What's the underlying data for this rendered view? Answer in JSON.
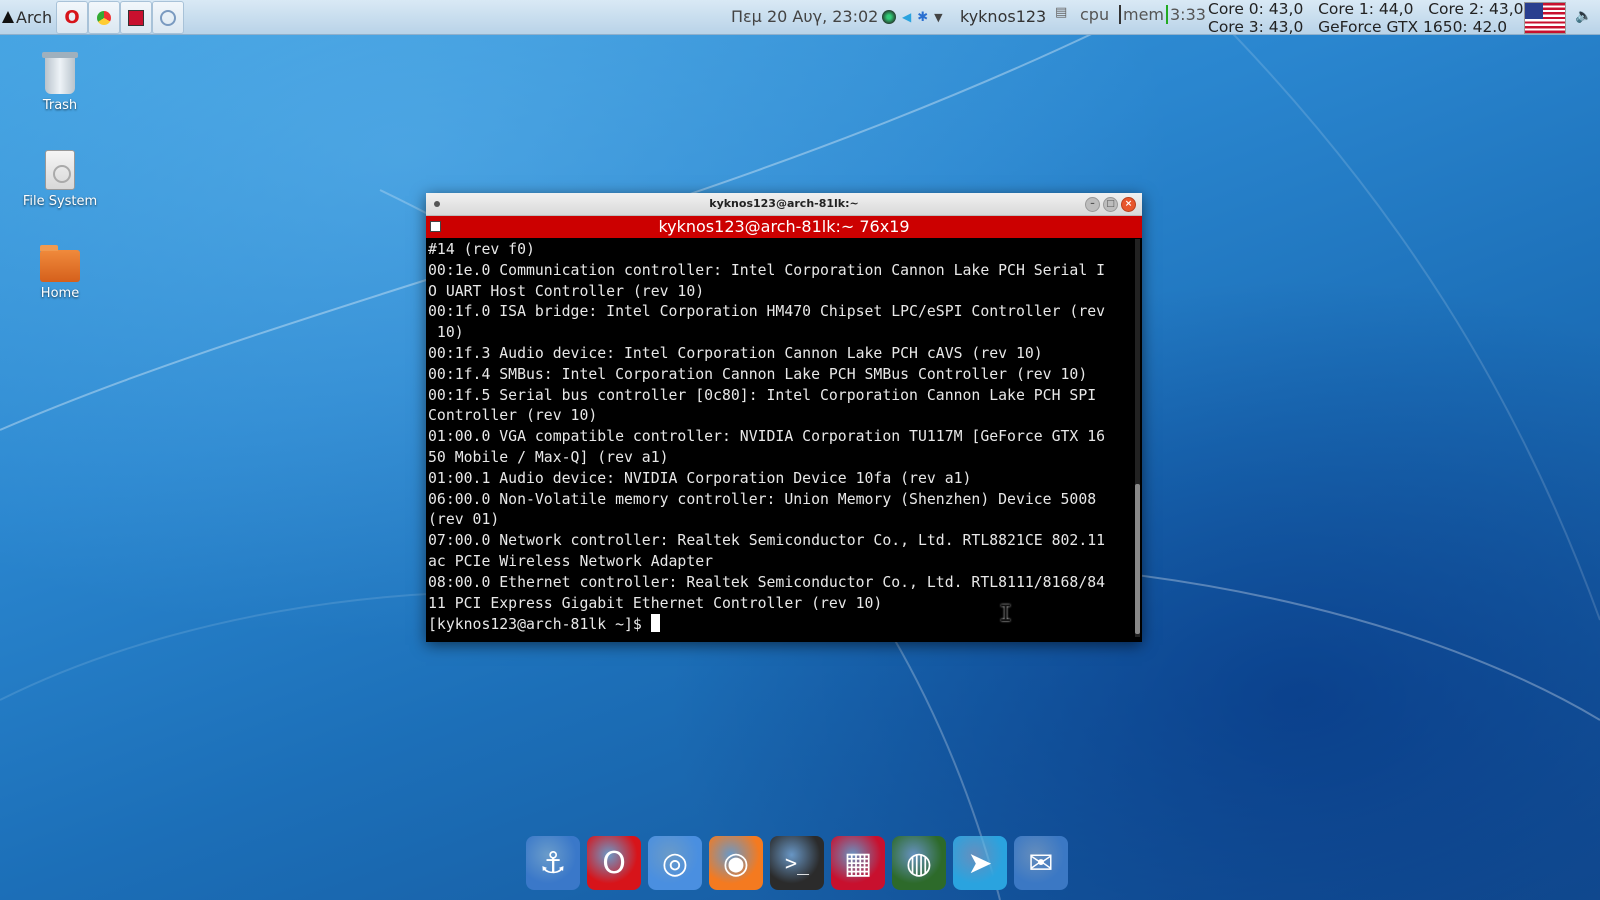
{
  "panel": {
    "menu_label": "Arch",
    "clock": "Πεμ 20 Αυγ, 23:02",
    "user": "kyknos123",
    "cpu_label": "cpu",
    "mem_label": "mem",
    "uptime": "3:33",
    "temps_line1": "Core 0: 43,0   Core 1: 44,0   Core 2: 43,0",
    "temps_line2": "Core 3: 43,0   GeForce GTX 1650: 42.0",
    "launchers": [
      "opera-icon",
      "chrome-icon",
      "terminal-icon",
      "telegram-icon"
    ]
  },
  "desktop": {
    "icons": [
      {
        "label": "Trash"
      },
      {
        "label": "File System"
      },
      {
        "label": "Home"
      }
    ]
  },
  "terminal": {
    "window_title": "kyknos123@arch-81lk:~",
    "tab_title": "kyknos123@arch-81lk:~ 76x19",
    "lines": [
      "#14 (rev f0)",
      "00:1e.0 Communication controller: Intel Corporation Cannon Lake PCH Serial I",
      "O UART Host Controller (rev 10)",
      "00:1f.0 ISA bridge: Intel Corporation HM470 Chipset LPC/eSPI Controller (rev",
      " 10)",
      "00:1f.3 Audio device: Intel Corporation Cannon Lake PCH cAVS (rev 10)",
      "00:1f.4 SMBus: Intel Corporation Cannon Lake PCH SMBus Controller (rev 10)",
      "00:1f.5 Serial bus controller [0c80]: Intel Corporation Cannon Lake PCH SPI",
      "Controller (rev 10)",
      "01:00.0 VGA compatible controller: NVIDIA Corporation TU117M [GeForce GTX 16",
      "50 Mobile / Max-Q] (rev a1)",
      "01:00.1 Audio device: NVIDIA Corporation Device 10fa (rev a1)",
      "06:00.0 Non-Volatile memory controller: Union Memory (Shenzhen) Device 5008",
      "(rev 01)",
      "07:00.0 Network controller: Realtek Semiconductor Co., Ltd. RTL8821CE 802.11",
      "ac PCIe Wireless Network Adapter",
      "08:00.0 Ethernet controller: Realtek Semiconductor Co., Ltd. RTL8111/8168/84",
      "11 PCI Express Gigabit Ethernet Controller (rev 10)"
    ],
    "prompt": "[kyknos123@arch-81lk ~]$ "
  },
  "dock": {
    "items": [
      {
        "name": "anchor-icon",
        "color": "#3a78c9"
      },
      {
        "name": "opera-icon",
        "color": "#d7141a"
      },
      {
        "name": "chrome-icon",
        "color": "#4a8fe0"
      },
      {
        "name": "firefox-icon",
        "color": "#f47a20"
      },
      {
        "name": "terminal-icon",
        "color": "#2b2b2b"
      },
      {
        "name": "red-window-icon",
        "color": "#c8102e"
      },
      {
        "name": "globe-icon",
        "color": "#2d6a2a"
      },
      {
        "name": "telegram-icon",
        "color": "#2aa3df"
      },
      {
        "name": "mail-icon",
        "color": "#3b78c4"
      }
    ]
  }
}
